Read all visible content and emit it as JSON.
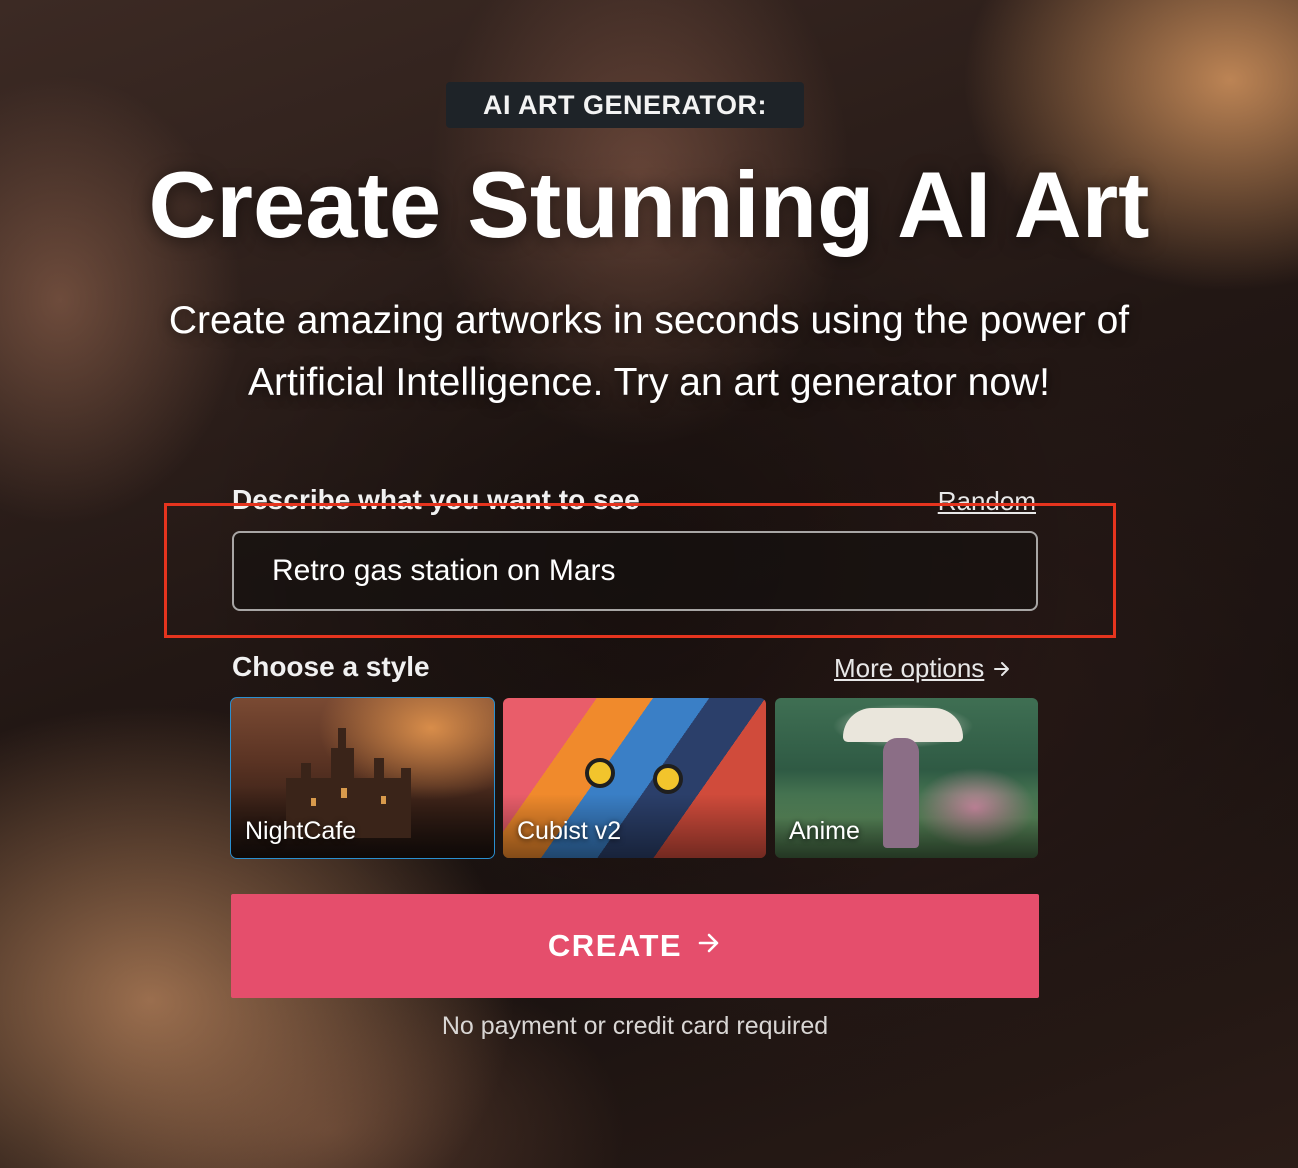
{
  "hero": {
    "eyebrow": "AI ART GENERATOR:",
    "title": "Create Stunning AI Art",
    "subtitle": "Create amazing artworks in seconds using the power of Artificial Intelligence. Try an art generator now!"
  },
  "prompt": {
    "label": "Describe what you want to see",
    "random_label": "Random",
    "value": "Retro gas station on Mars"
  },
  "styles": {
    "label": "Choose a style",
    "more_options_label": "More options",
    "items": [
      {
        "name": "NightCafe",
        "selected": true
      },
      {
        "name": "Cubist v2",
        "selected": false
      },
      {
        "name": "Anime",
        "selected": false
      }
    ]
  },
  "cta": {
    "create_label": "CREATE",
    "note": "No payment or credit card required"
  },
  "colors": {
    "accent": "#e54e6c",
    "selected_outline": "#2a8fd0",
    "highlight_box": "#e5341e"
  },
  "icons": {
    "more_options_arrow": "arrow-right-icon",
    "create_arrow": "arrow-right-icon"
  }
}
